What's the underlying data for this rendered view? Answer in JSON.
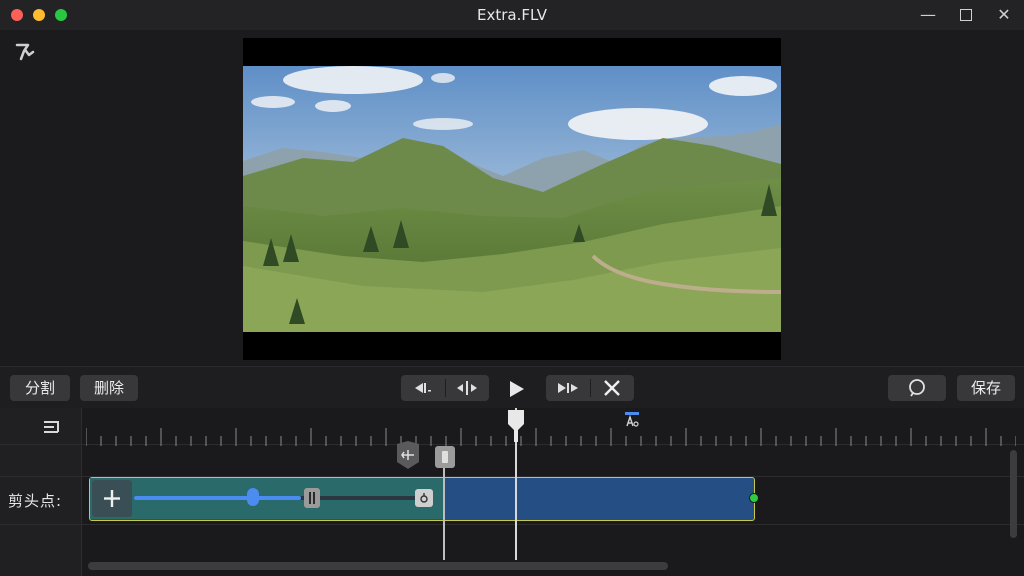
{
  "window": {
    "title": "Extra.FLV",
    "minimize_glyph": "—",
    "close_glyph": "✕"
  },
  "toolbar": {
    "split_label": "分割",
    "delete_label": "删除",
    "icons": [
      "trim-start-icon",
      "split-center-icon",
      "play-icon",
      "trim-end-icon",
      "scissors-icon",
      "comment-icon"
    ],
    "save_label": "保存"
  },
  "timeline": {
    "track_label": "剪头点:",
    "playhead_position": 0.5,
    "slider_fill_fraction": 0.58
  },
  "colors": {
    "accent": "#4a8cf0",
    "clip_blue": "#254e85",
    "clip_teal": "#2b6a6a",
    "clip_border": "#c8c84a",
    "end_point": "#2ecc40"
  }
}
